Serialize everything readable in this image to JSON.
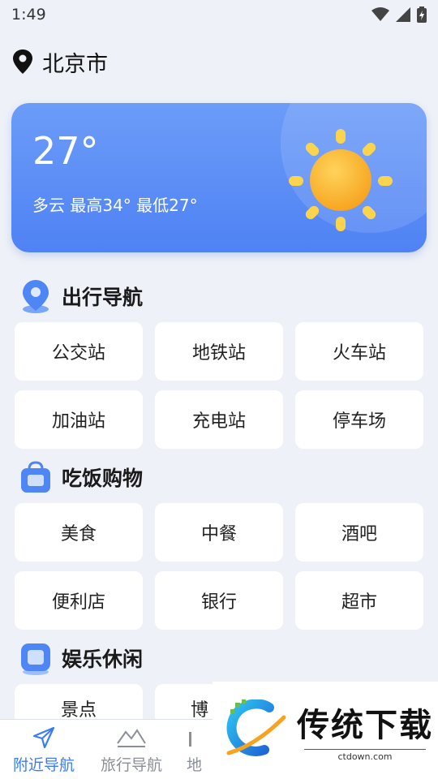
{
  "status_bar": {
    "time": "1:49"
  },
  "location": {
    "city": "北京市"
  },
  "weather": {
    "temperature": "27°",
    "description": "多云 最高34° 最低27°",
    "icon": "sun-icon"
  },
  "sections": [
    {
      "title": "出行导航",
      "icon": "location-pin-badge-icon",
      "items": [
        "公交站",
        "地铁站",
        "火车站",
        "加油站",
        "充电站",
        "停车场"
      ]
    },
    {
      "title": "吃饭购物",
      "icon": "shopping-bag-badge-icon",
      "items": [
        "美食",
        "中餐",
        "酒吧",
        "便利店",
        "银行",
        "超市"
      ]
    },
    {
      "title": "娱乐休闲",
      "icon": "entertainment-badge-icon",
      "items": [
        "景点",
        "博"
      ]
    }
  ],
  "bottom_nav": [
    {
      "label": "附近导航",
      "icon": "paper-plane-icon",
      "active": true
    },
    {
      "label": "旅行导航",
      "icon": "mountain-icon",
      "active": false
    },
    {
      "label": "地",
      "icon": "map-icon",
      "active": false
    }
  ],
  "watermark": {
    "title": "传统下载",
    "subtitle": "ctdown.com"
  },
  "colors": {
    "accent": "#3b7cf6",
    "card": "#5a8cf6",
    "sun": "#fbb829"
  }
}
